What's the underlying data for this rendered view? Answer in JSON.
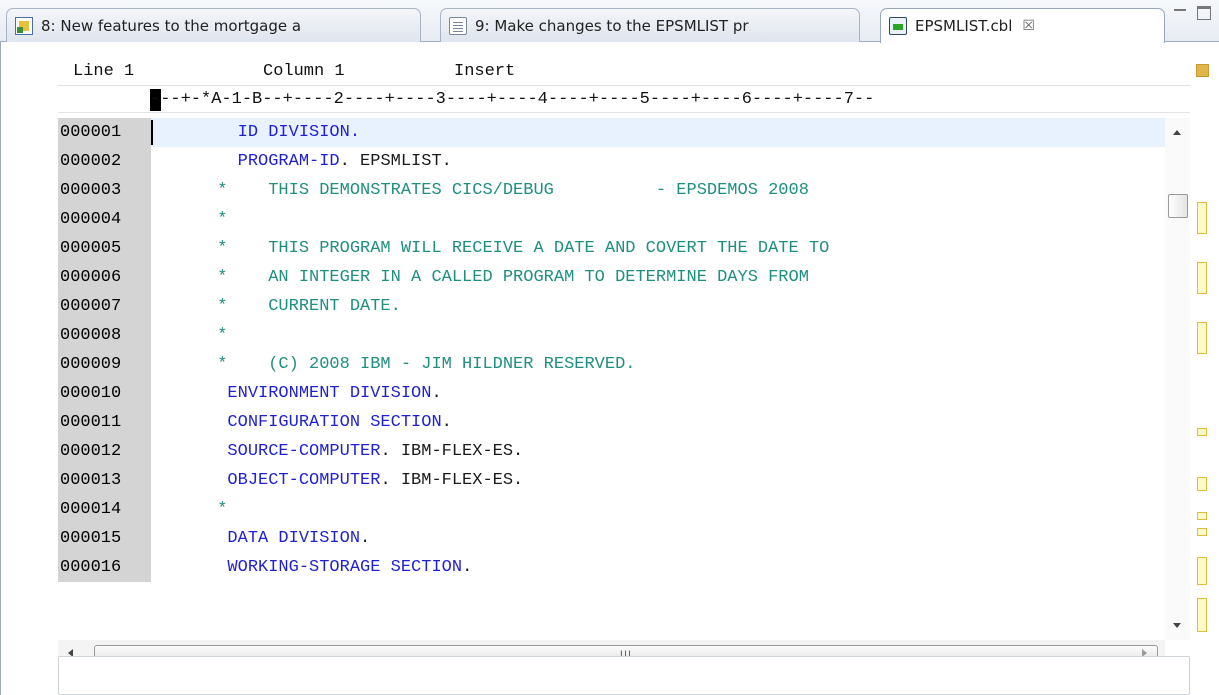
{
  "tabs": [
    {
      "label": "8: New features to the mortgage a",
      "icon": "task-icon"
    },
    {
      "label": "9: Make changes to the EPSMLIST pr",
      "icon": "document-icon"
    },
    {
      "label": "EPSMLIST.cbl",
      "icon": "cobol-file-icon",
      "close": "☒",
      "active": true
    }
  ],
  "status": {
    "line": "Line 1",
    "column": "Column 1",
    "mode": "Insert"
  },
  "ruler": "---+-*A-1-B--+----2----+----3----+----4----+----5----+----6----+----7--",
  "code_lines": [
    {
      "num": "000001",
      "segments": [
        {
          "t": "        ID DIVISION.",
          "c": "kw"
        }
      ]
    },
    {
      "num": "000002",
      "segments": [
        {
          "t": "        PROGRAM-ID",
          "c": "kw"
        },
        {
          "t": ". EPSMLIST.",
          "c": "plain"
        }
      ]
    },
    {
      "num": "000003",
      "segments": [
        {
          "t": "      *    THIS DEMONSTRATES CICS/DEBUG          - EPSDEMOS 2008",
          "c": "cmt"
        }
      ]
    },
    {
      "num": "000004",
      "segments": [
        {
          "t": "      *",
          "c": "cmt"
        }
      ]
    },
    {
      "num": "000005",
      "segments": [
        {
          "t": "      *    THIS PROGRAM WILL RECEIVE A DATE AND COVERT THE DATE TO",
          "c": "cmt"
        }
      ]
    },
    {
      "num": "000006",
      "segments": [
        {
          "t": "      *    AN INTEGER IN A CALLED PROGRAM TO DETERMINE DAYS FROM",
          "c": "cmt"
        }
      ]
    },
    {
      "num": "000007",
      "segments": [
        {
          "t": "      *    CURRENT DATE.",
          "c": "cmt"
        }
      ]
    },
    {
      "num": "000008",
      "segments": [
        {
          "t": "      *",
          "c": "cmt"
        }
      ]
    },
    {
      "num": "000009",
      "segments": [
        {
          "t": "      *    (C) 2008 IBM - JIM HILDNER RESERVED.",
          "c": "cmt"
        }
      ]
    },
    {
      "num": "000010",
      "segments": [
        {
          "t": "       ENVIRONMENT DIVISION",
          "c": "kw"
        },
        {
          "t": ".",
          "c": "plain"
        }
      ]
    },
    {
      "num": "000011",
      "segments": [
        {
          "t": "       CONFIGURATION SECTION",
          "c": "kw"
        },
        {
          "t": ".",
          "c": "plain"
        }
      ]
    },
    {
      "num": "000012",
      "segments": [
        {
          "t": "       SOURCE-COMPUTER",
          "c": "kw"
        },
        {
          "t": ". IBM-FLEX-ES.",
          "c": "plain"
        }
      ]
    },
    {
      "num": "000013",
      "segments": [
        {
          "t": "       OBJECT-COMPUTER",
          "c": "kw"
        },
        {
          "t": ". IBM-FLEX-ES.",
          "c": "plain"
        }
      ]
    },
    {
      "num": "000014",
      "segments": [
        {
          "t": "      *",
          "c": "cmt"
        }
      ]
    },
    {
      "num": "000015",
      "segments": [
        {
          "t": "       DATA DIVISION",
          "c": "kw"
        },
        {
          "t": ".",
          "c": "plain"
        }
      ]
    },
    {
      "num": "000016",
      "segments": [
        {
          "t": "       WORKING-STORAGE SECTION",
          "c": "kw"
        },
        {
          "t": ".",
          "c": "plain"
        }
      ]
    }
  ],
  "hscroll_grip": "III",
  "colors": {
    "keyword": "#1f1fd6",
    "comment": "#1f8f7f",
    "plain": "#1a1a1a",
    "current_line": "#e8f2fe",
    "gutter": "#d4d4d4"
  }
}
